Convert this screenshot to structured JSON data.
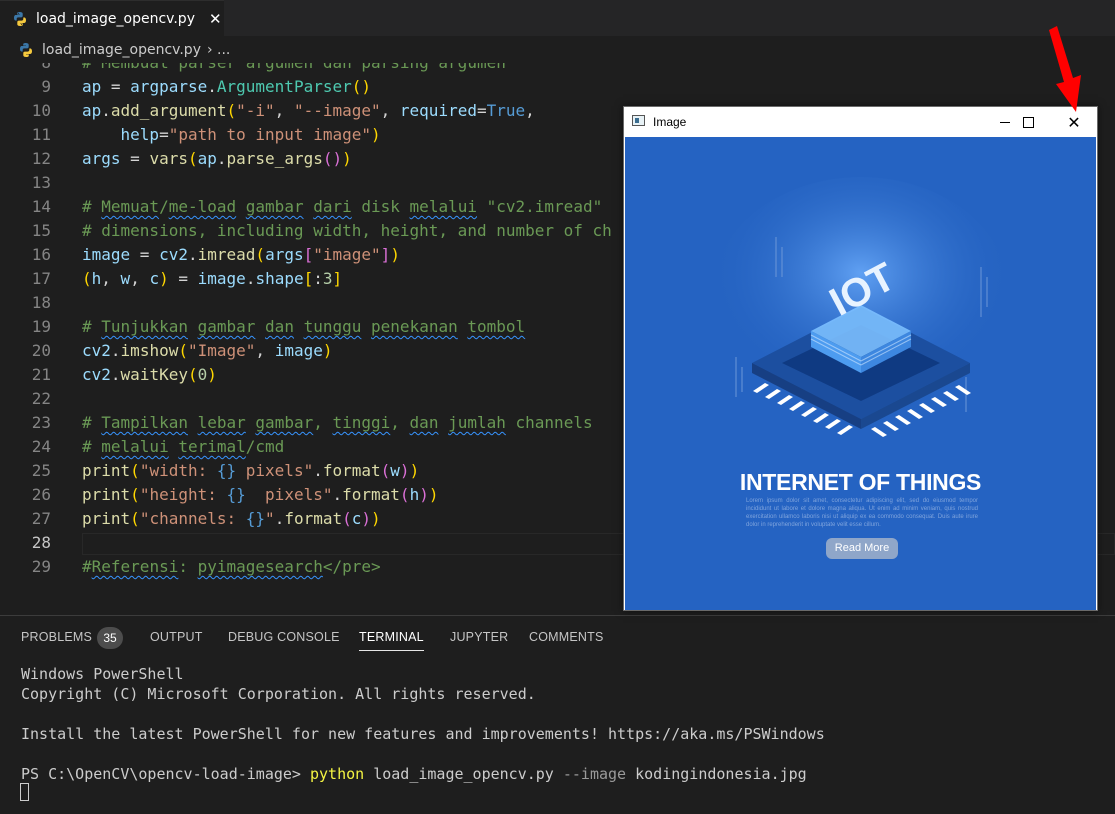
{
  "tab": {
    "label": "load_image_opencv.py",
    "close": "✕"
  },
  "breadcrumb": {
    "file": "load_image_opencv.py",
    "rest": "› ..."
  },
  "editor": {
    "lines": [
      {
        "n": "8",
        "html": "<span class='c-com'># Membuat parser argumen dan parsing argumen</span>"
      },
      {
        "n": "9",
        "html": "<span class='c-var'>ap</span> = <span class='c-var'>argparse</span>.<span class='c-cls'>ArgumentParser</span><span class='c-p1'>()</span>"
      },
      {
        "n": "10",
        "html": "<span class='c-var'>ap</span>.<span class='c-fn'>add_argument</span><span class='c-p1'>(</span><span class='c-str'>\"-i\"</span>, <span class='c-str'>\"--image\"</span>, <span class='c-var'>required</span>=<span class='c-kw'>True</span>,"
      },
      {
        "n": "11",
        "html": "    <span class='c-var'>help</span>=<span class='c-str'>\"path to input image\"</span><span class='c-p1'>)</span>"
      },
      {
        "n": "12",
        "html": "<span class='c-var'>args</span> = <span class='c-fn'>vars</span><span class='c-p1'>(</span><span class='c-var'>ap</span>.<span class='c-fn'>parse_args</span><span class='c-p2'>()</span><span class='c-p1'>)</span>"
      },
      {
        "n": "13",
        "html": ""
      },
      {
        "n": "14",
        "html": "<span class='c-com'># <span class='c-wavy'>Memuat</span>/<span class='c-wavy'>me-load</span> <span class='c-wavy'>gambar</span> <span class='c-wavy'>dari</span> disk <span class='c-wavy'>melalui</span> \"cv2.imread\"</span>"
      },
      {
        "n": "15",
        "html": "<span class='c-com'># dimensions, including width, height, and number of ch</span>"
      },
      {
        "n": "16",
        "html": "<span class='c-var'>image</span> = <span class='c-var'>cv2</span>.<span class='c-fn'>imread</span><span class='c-p1'>(</span><span class='c-var'>args</span><span class='c-p2'>[</span><span class='c-str'>\"image\"</span><span class='c-p2'>]</span><span class='c-p1'>)</span>"
      },
      {
        "n": "17",
        "html": "<span class='c-p1'>(</span><span class='c-var'>h</span>, <span class='c-var'>w</span>, <span class='c-var'>c</span><span class='c-p1'>)</span> = <span class='c-var'>image</span>.<span class='c-var'>shape</span><span class='c-p1'>[</span>:<span class='c-num'>3</span><span class='c-p1'>]</span>"
      },
      {
        "n": "18",
        "html": ""
      },
      {
        "n": "19",
        "html": "<span class='c-com'># <span class='c-wavy'>Tunjukkan</span> <span class='c-wavy'>gambar</span> <span class='c-wavy'>dan</span> <span class='c-wavy'>tunggu</span> <span class='c-wavy'>penekanan</span> <span class='c-wavy'>tombol</span></span>"
      },
      {
        "n": "20",
        "html": "<span class='c-var'>cv2</span>.<span class='c-fn'>imshow</span><span class='c-p1'>(</span><span class='c-str'>\"Image\"</span>, <span class='c-var'>image</span><span class='c-p1'>)</span>"
      },
      {
        "n": "21",
        "html": "<span class='c-var'>cv2</span>.<span class='c-fn'>waitKey</span><span class='c-p1'>(</span><span class='c-num'>0</span><span class='c-p1'>)</span>"
      },
      {
        "n": "22",
        "html": ""
      },
      {
        "n": "23",
        "html": "<span class='c-com'># <span class='c-wavy'>Tampilkan</span> <span class='c-wavy'>lebar</span> <span class='c-wavy'>gambar</span>, <span class='c-wavy'>tinggi</span>, <span class='c-wavy'>dan</span> <span class='c-wavy'>jumlah</span> channels</span>"
      },
      {
        "n": "24",
        "html": "<span class='c-com'># <span class='c-wavy'>melalui</span> <span class='c-wavy'>terimal</span>/cmd</span>"
      },
      {
        "n": "25",
        "html": "<span class='c-fn'>print</span><span class='c-p1'>(</span><span class='c-str'>\"width: </span><span class='c-kw'>{}</span><span class='c-str'> pixels\"</span>.<span class='c-fn'>format</span><span class='c-p2'>(</span><span class='c-var'>w</span><span class='c-p2'>)</span><span class='c-p1'>)</span>"
      },
      {
        "n": "26",
        "html": "<span class='c-fn'>print</span><span class='c-p1'>(</span><span class='c-str'>\"height: </span><span class='c-kw'>{}</span><span class='c-str'>  pixels\"</span>.<span class='c-fn'>format</span><span class='c-p2'>(</span><span class='c-var'>h</span><span class='c-p2'>)</span><span class='c-p1'>)</span>"
      },
      {
        "n": "27",
        "html": "<span class='c-fn'>print</span><span class='c-p1'>(</span><span class='c-str'>\"channels: </span><span class='c-kw'>{}</span><span class='c-str'>\"</span>.<span class='c-fn'>format</span><span class='c-p2'>(</span><span class='c-var'>c</span><span class='c-p2'>)</span><span class='c-p1'>)</span>"
      },
      {
        "n": "28",
        "html": ""
      },
      {
        "n": "29",
        "html": "<span class='c-com'>#<span class='c-wavy'>Referensi</span>: <span class='c-wavy'>pyimagesearch</span>&lt;/pre&gt;</span>"
      }
    ],
    "current_line": "28"
  },
  "panel": {
    "tabs": [
      "PROBLEMS",
      "OUTPUT",
      "DEBUG CONSOLE",
      "TERMINAL",
      "JUPYTER",
      "COMMENTS"
    ],
    "active_tab": "TERMINAL",
    "problems_count": "35",
    "terminal": {
      "line1": "Windows PowerShell",
      "line2": "Copyright (C) Microsoft Corporation. All rights reserved.",
      "line3": "Install the latest PowerShell for new features and improvements! https://aka.ms/PSWindows",
      "prompt": "PS C:\\OpenCV\\opencv-load-image> ",
      "cmd": "python",
      "arg1": " load_image_opencv.py ",
      "flag": "--image",
      "arg2": " kodingindonesia.jpg"
    }
  },
  "image_window": {
    "title": "Image",
    "minimize": "minimize",
    "maximize": "maximize",
    "close": "✕",
    "poster": {
      "chip_text": "IOT",
      "title": "INTERNET OF THINGS",
      "body": "Lorem ipsum dolor sit amet, consectetur adipiscing elit, sed do eiusmod tempor incididunt ut labore et dolore magna aliqua. Ut enim ad minim veniam, quis nostrud exercitation ullamco laboris nisi ut aliquip ex ea commodo consequat. Duis aute irure dolor in reprehenderit in voluptate velit esse cillum.",
      "button": "Read More",
      "bg_color": "#2563c2"
    }
  },
  "annotation": {
    "arrow_color": "#ff0000"
  }
}
